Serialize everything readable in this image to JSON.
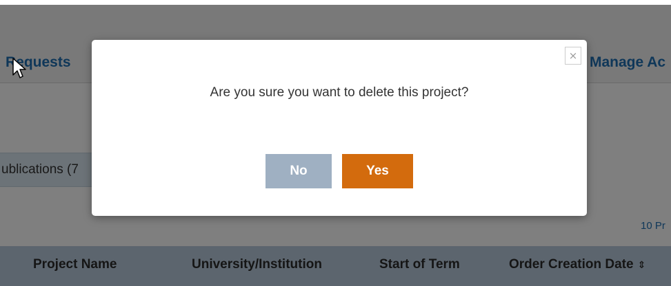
{
  "nav": {
    "left_link": "Requests",
    "right_link": "Manage Ac"
  },
  "tabs": {
    "publications_label": "ublications (7"
  },
  "pagination": {
    "per_page_label": "10 Pr"
  },
  "table": {
    "columns": [
      "Project Name",
      "University/Institution",
      "Start of Term",
      "Order Creation Date"
    ]
  },
  "dialog": {
    "message": "Are you sure you want to delete this project?",
    "close_symbol": "×",
    "no_label": "No",
    "yes_label": "Yes"
  },
  "icons": {
    "close": "close-icon",
    "sort": "sort-icon",
    "cursor": "mouse-cursor"
  },
  "colors": {
    "link": "#1f6fb2",
    "yes_button": "#d36b0d",
    "no_button": "#9fb0c2",
    "table_header": "#b9cbdc"
  }
}
